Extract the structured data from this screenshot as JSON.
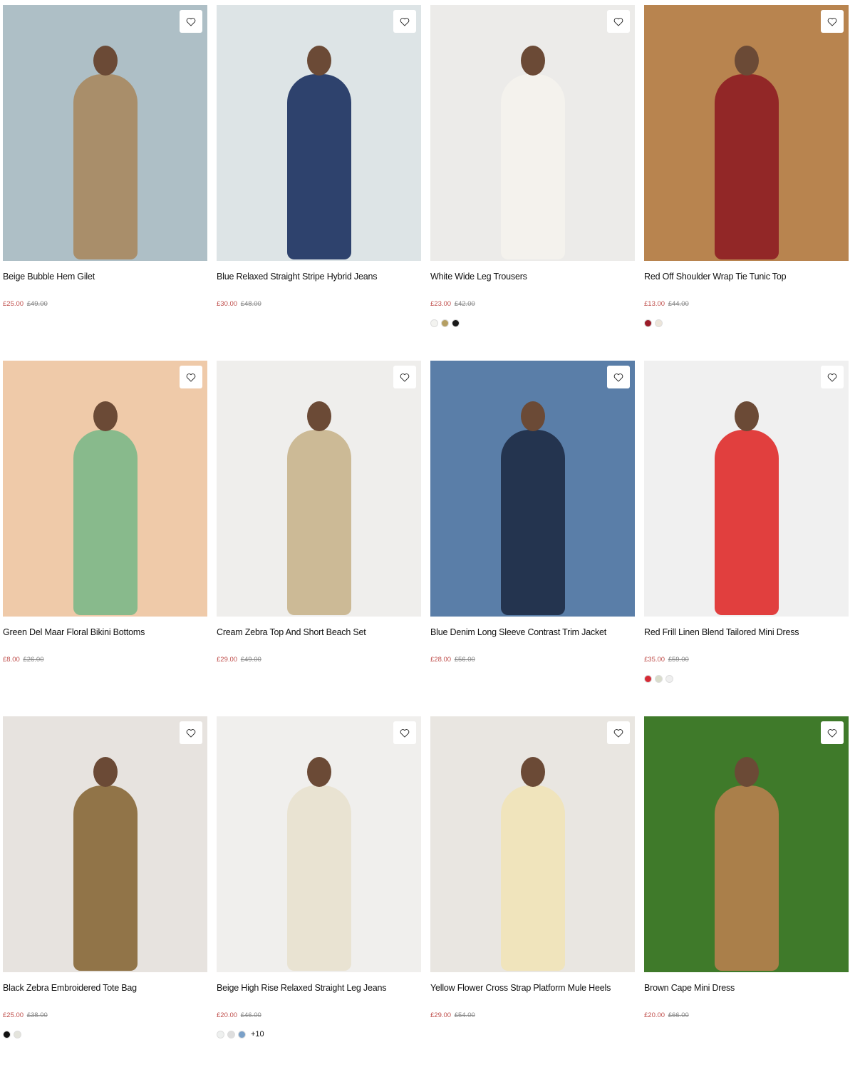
{
  "products": [
    {
      "name": "Beige Bubble Hem Gilet",
      "price": "£25.00",
      "was": "£49.00",
      "bg": "#aebfc6",
      "garment": "#a88a62",
      "swatches": []
    },
    {
      "name": "Blue Relaxed Straight Stripe Hybrid Jeans",
      "price": "£30.00",
      "was": "£48.00",
      "bg": "#dde4e6",
      "garment": "#1e3463",
      "swatches": []
    },
    {
      "name": "White Wide Leg Trousers",
      "price": "£23.00",
      "was": "£42.00",
      "bg": "#ecebe9",
      "garment": "#f4f2ed",
      "swatches": [
        "#f3f3f0",
        "#b59f63",
        "#1a1a1a"
      ]
    },
    {
      "name": "Red Off Shoulder Wrap Tie Tunic Top",
      "price": "£13.00",
      "was": "£44.00",
      "bg": "#b8844f",
      "garment": "#8e1f24",
      "swatches": [
        "#9b1b28",
        "#ece5da"
      ]
    },
    {
      "name": "Green Del Maar Floral Bikini Bottoms",
      "price": "£8.00",
      "was": "£26.00",
      "bg": "#efcaa9",
      "garment": "#7fb88a",
      "swatches": []
    },
    {
      "name": "Cream Zebra Top And Short Beach Set",
      "price": "£29.00",
      "was": "£49.00",
      "bg": "#efeeec",
      "garment": "#c9b58e",
      "swatches": []
    },
    {
      "name": "Blue Denim Long Sleeve Contrast Trim Jacket",
      "price": "£28.00",
      "was": "£56.00",
      "bg": "#5a7ea8",
      "garment": "#1f2e48",
      "swatches": []
    },
    {
      "name": "Red Frill Linen Blend Tailored Mini Dress",
      "price": "£35.00",
      "was": "£59.00",
      "bg": "#f0f0f0",
      "garment": "#e0302f",
      "swatches": [
        "#d62a35",
        "#d9dccb",
        "#efefef"
      ]
    },
    {
      "name": "Black Zebra Embroidered Tote Bag",
      "price": "£25.00",
      "was": "£38.00",
      "bg": "#e7e3df",
      "garment": "#8a6a3b",
      "swatches": [
        "#111111",
        "#e4e4dc"
      ]
    },
    {
      "name": "Beige High Rise Relaxed Straight Leg Jeans",
      "price": "£20.00",
      "was": "£46.00",
      "bg": "#f0efed",
      "garment": "#e8e2cf",
      "swatches": [
        "#eef0ef",
        "#dedede",
        "#7aa0c8"
      ],
      "more": "+10"
    },
    {
      "name": "Yellow Flower Cross Strap Platform Mule Heels",
      "price": "£29.00",
      "was": "£54.00",
      "bg": "#e9e6e1",
      "garment": "#f0e4b8",
      "swatches": []
    },
    {
      "name": "Brown Cape Mini Dress",
      "price": "£20.00",
      "was": "£66.00",
      "bg": "#3f7a2a",
      "garment": "#b37f4d",
      "swatches": []
    }
  ],
  "icons": {
    "wishlist": "heart-outline-icon"
  }
}
